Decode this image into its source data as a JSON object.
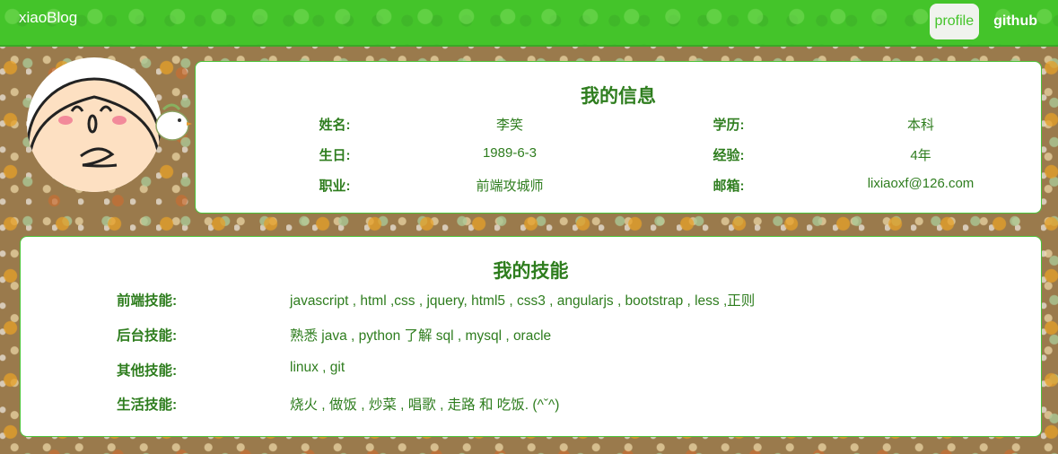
{
  "navbar": {
    "brand": "xiaoBlog",
    "links": [
      {
        "label": "profile",
        "active": true
      },
      {
        "label": "github",
        "active": false
      }
    ],
    "color": "#44c42a"
  },
  "info": {
    "title": "我的信息",
    "rows": [
      {
        "label1": "姓名:",
        "value1": "李笑",
        "label2": "学历:",
        "value2": "本科"
      },
      {
        "label1": "生日:",
        "value1": "1989-6-3",
        "label2": "经验:",
        "value2": "4年"
      },
      {
        "label1": "职业:",
        "value1": "前端攻城师",
        "label2": "邮箱:",
        "value2": "lixiaoxf@126.com"
      }
    ]
  },
  "skills": {
    "title": "我的技能",
    "rows": [
      {
        "label": "前端技能:",
        "value": "javascript , html ,css , jquery, html5 , css3 , angularjs , bootstrap , less ,正则"
      },
      {
        "label": "后台技能:",
        "value": "熟悉 java , python 了解 sql , mysql , oracle"
      },
      {
        "label": "其他技能:",
        "value": "linux , git"
      },
      {
        "label": "生活技能:",
        "value": "烧火 , 做饭 , 炒菜 , 唱歌 , 走路 和 吃饭. (^ˇ^)"
      }
    ]
  },
  "text_color": "#2e7d1e"
}
